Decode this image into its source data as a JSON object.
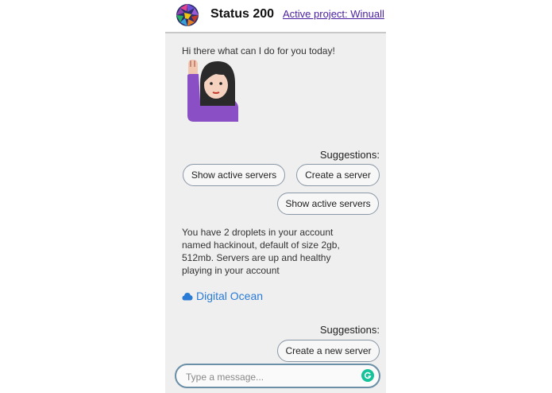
{
  "header": {
    "title": "Status 200",
    "project_link": "Active project: Winuall"
  },
  "chat": {
    "greeting": "Hi there what can I do for you today!",
    "avatar_icon": "woman-raising-hand-emoji",
    "suggestions_1": {
      "label": "Suggestions:",
      "chips": [
        "Show active servers",
        "Create a server",
        "Show active servers"
      ]
    },
    "bot_reply": [
      "You have 2 droplets in your account",
      "named hackinout, default of size 2gb,",
      "512mb. Servers are up and healthy",
      "playing in your account"
    ],
    "provider_link": "Digital Ocean",
    "provider_icon": "cloud-icon",
    "suggestions_2": {
      "label": "Suggestions:",
      "chips": [
        "Create a new server"
      ]
    }
  },
  "composer": {
    "placeholder": "Type a message...",
    "send_icon": "grammarly-icon"
  },
  "colors": {
    "link_purple": "#4a1fa0",
    "provider_blue": "#2a7bd5",
    "chat_bg": "#efefef",
    "send_green": "#15c39a"
  }
}
